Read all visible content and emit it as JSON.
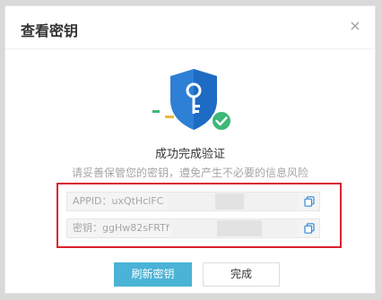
{
  "dialog": {
    "title": "查看密钥",
    "close_symbol": "×"
  },
  "status": {
    "title": "成功完成验证",
    "description": "请妥善保管您的密钥，遵免产生不必要的信息风险"
  },
  "keys": {
    "appid_text": "APPID：uxQtHclFC",
    "secret_text": "密钥：ggHw82sFRTf"
  },
  "buttons": {
    "refresh_label": "刷新密钥",
    "done_label": "完成"
  },
  "colors": {
    "primary": "#4ab3d6",
    "shield": "#2e7fd6",
    "success_badge": "#3cb878",
    "highlight": "#d9212f"
  },
  "icons": {
    "shield": "shield-key-icon",
    "badge": "check-badge-icon",
    "copy": "copy-icon",
    "close": "close-icon"
  }
}
